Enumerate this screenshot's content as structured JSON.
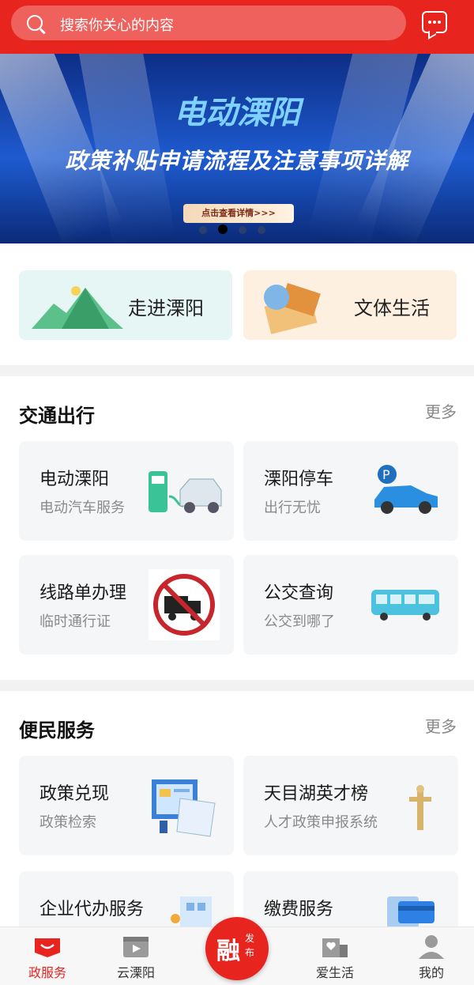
{
  "search": {
    "placeholder": "搜索你关心的内容"
  },
  "banner": {
    "title": "电动溧阳",
    "subtitle": "政策补贴申请流程及注意事项详解",
    "button": "点击查看详情>>>"
  },
  "entries": [
    {
      "label": "走进溧阳"
    },
    {
      "label": "文体生活"
    }
  ],
  "traffic": {
    "title": "交通出行",
    "more": "更多",
    "cards": [
      {
        "title": "电动溧阳",
        "subtitle": "电动汽车服务"
      },
      {
        "title": "溧阳停车",
        "subtitle": "出行无忧"
      },
      {
        "title": "线路单办理",
        "subtitle": "临时通行证"
      },
      {
        "title": "公交查询",
        "subtitle": "公交到哪了"
      }
    ]
  },
  "services": {
    "title": "便民服务",
    "more": "更多",
    "cards": [
      {
        "title": "政策兑现",
        "subtitle": "政策检索"
      },
      {
        "title": "天目湖英才榜",
        "subtitle": "人才政策申报系统"
      },
      {
        "title": "企业代办服务",
        "subtitle": ""
      },
      {
        "title": "缴费服务",
        "subtitle": ""
      }
    ]
  },
  "nav": {
    "items": [
      {
        "label": "政服务",
        "icon": "gov-service-icon",
        "active": true
      },
      {
        "label": "云溧阳",
        "icon": "video-icon",
        "active": false
      },
      {
        "label": "爱生活",
        "icon": "life-icon",
        "active": false
      },
      {
        "label": "我的",
        "icon": "profile-icon",
        "active": false
      }
    ],
    "center": {
      "big": "融",
      "small": "发布"
    }
  },
  "colors": {
    "brand": "#e8241f",
    "banner": "#1e5bd0"
  }
}
